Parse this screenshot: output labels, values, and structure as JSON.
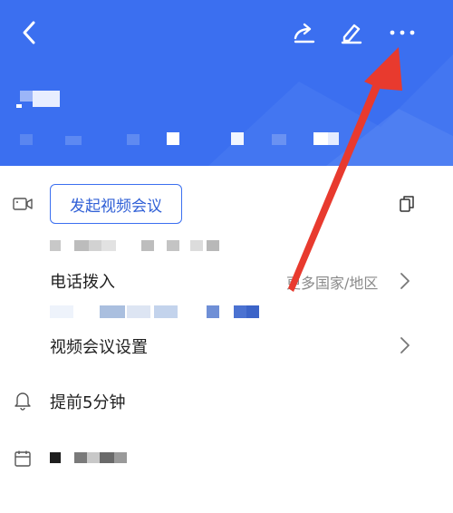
{
  "header": {
    "back_icon": "chevron-left-icon",
    "share_icon": "share-icon",
    "edit_icon": "pencil-icon",
    "more_icon": "more-dots-icon",
    "accent_color": "#3b6ff0"
  },
  "meeting": {
    "video_button_label": "发起视频会议",
    "copy_icon": "copy-icon",
    "dial_in_label": "电话拨入",
    "more_regions_label": "更多国家/地区",
    "video_settings_label": "视频会议设置",
    "reminder_label": "提前5分钟"
  },
  "annotation": {
    "arrow_color": "#e83a2e"
  }
}
